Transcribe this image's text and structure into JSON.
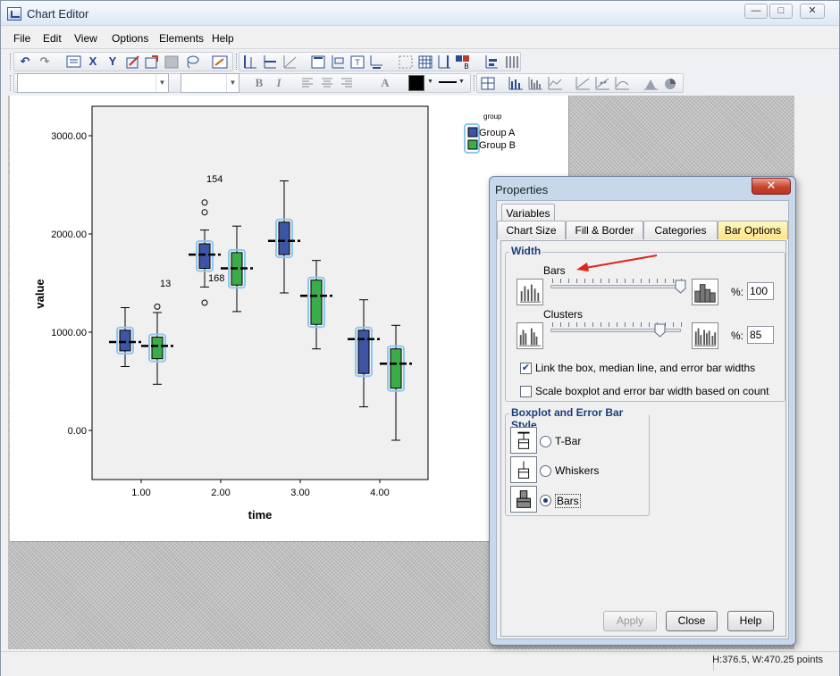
{
  "window": {
    "title": "Chart Editor"
  },
  "menu": {
    "items": [
      "File",
      "Edit",
      "View",
      "Options",
      "Elements",
      "Help"
    ]
  },
  "status": {
    "size_readout": "H:376.5, W:470.25 points"
  },
  "chart": {
    "xlabel": "time",
    "ylabel": "value",
    "y_ticks": [
      "3000.00",
      "2000.00",
      "1000.00",
      "0.00"
    ],
    "x_ticks": [
      "1.00",
      "2.00",
      "3.00",
      "4.00"
    ],
    "legend_title": "group",
    "legend": [
      {
        "name": "Group A",
        "color": "#3d55a4"
      },
      {
        "name": "Group B",
        "color": "#3aad4a"
      }
    ],
    "outlier_labels": [
      "154",
      "168",
      "13"
    ]
  },
  "chart_data": {
    "type": "boxplot",
    "xlabel": "time",
    "ylabel": "value",
    "categories": [
      "1.00",
      "2.00",
      "3.00",
      "4.00"
    ],
    "ylim": [
      -500,
      3300
    ],
    "legend_title": "group",
    "legend_position": "top-right",
    "series": [
      {
        "name": "Group A",
        "color": "#3d55a4",
        "boxes": [
          {
            "min": 650,
            "q1": 810,
            "median": 900,
            "q3": 1020,
            "max": 1250,
            "outliers": []
          },
          {
            "min": 1460,
            "q1": 1650,
            "median": 1790,
            "q3": 1900,
            "max": 2040,
            "outliers": [
              2220,
              2320,
              1300
            ]
          },
          {
            "min": 1400,
            "q1": 1790,
            "median": 1930,
            "q3": 2120,
            "max": 2540,
            "outliers": []
          },
          {
            "min": 240,
            "q1": 580,
            "median": 930,
            "q3": 1020,
            "max": 1330,
            "outliers": []
          }
        ]
      },
      {
        "name": "Group B",
        "color": "#3aad4a",
        "boxes": [
          {
            "min": 470,
            "q1": 730,
            "median": 860,
            "q3": 950,
            "max": 1200,
            "outliers": [
              1260
            ]
          },
          {
            "min": 1210,
            "q1": 1480,
            "median": 1650,
            "q3": 1810,
            "max": 2080,
            "outliers": []
          },
          {
            "min": 830,
            "q1": 1080,
            "median": 1370,
            "q3": 1530,
            "max": 1730,
            "outliers": []
          },
          {
            "min": -100,
            "q1": 430,
            "median": 680,
            "q3": 830,
            "max": 1070,
            "outliers": []
          }
        ]
      }
    ]
  },
  "dialog": {
    "title": "Properties",
    "tabs_row1": [
      "Variables"
    ],
    "tabs_row2": [
      "Chart Size",
      "Fill & Border",
      "Categories",
      "Bar Options"
    ],
    "active_tab": "Bar Options",
    "width_group": {
      "title": "Width",
      "bars_label": "Bars",
      "bars_percent_label": "%:",
      "bars_value": "100",
      "clusters_label": "Clusters",
      "clusters_percent_label": "%:",
      "clusters_value": "85",
      "link_label": "Link the box, median line, and error bar widths",
      "link_checked": true,
      "scale_label": "Scale boxplot and error bar width based on count",
      "scale_checked": false
    },
    "style_group": {
      "title": "Boxplot and Error Bar Style",
      "options": [
        "T-Bar",
        "Whiskers",
        "Bars"
      ],
      "selected": "Bars"
    },
    "buttons": {
      "apply": "Apply",
      "close": "Close",
      "help": "Help"
    }
  }
}
